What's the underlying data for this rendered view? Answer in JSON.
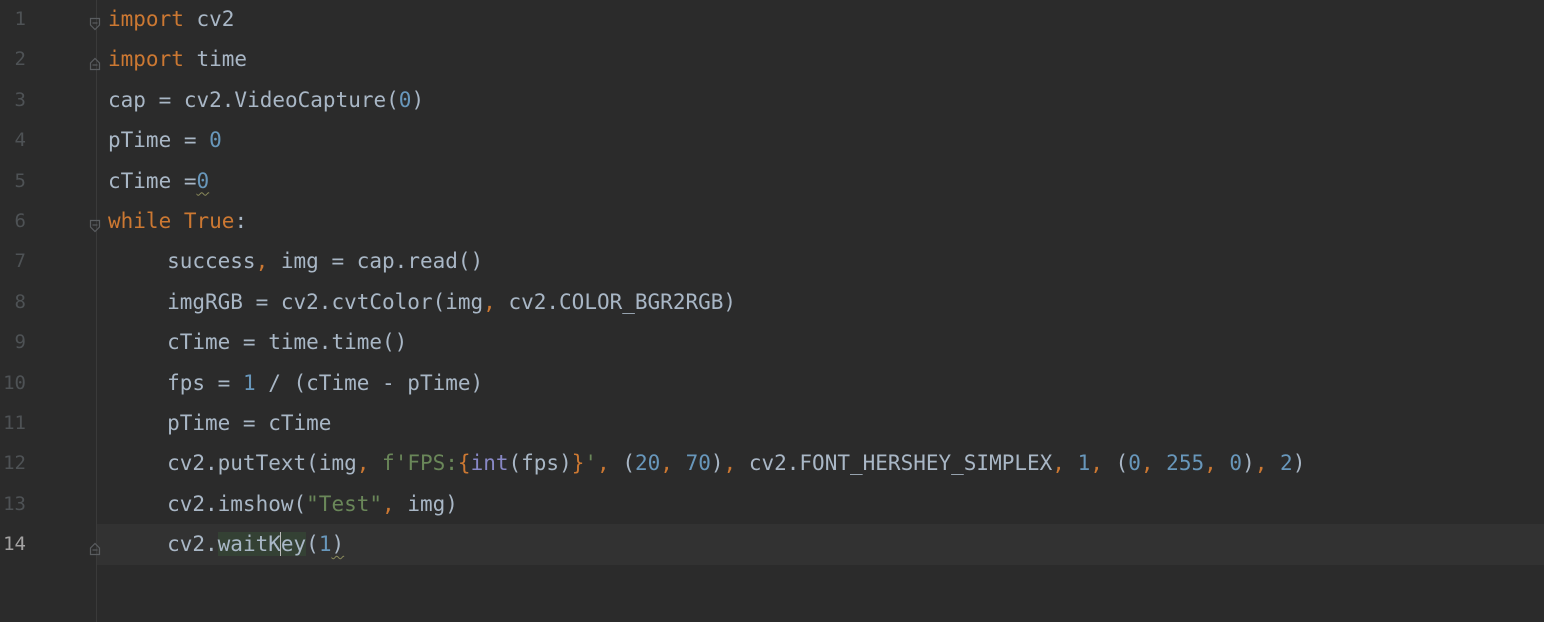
{
  "editor": {
    "current_line": 14,
    "caret": {
      "line": 14,
      "column": 14
    },
    "colors": {
      "background": "#2b2b2b",
      "current_line_background": "#323232",
      "keyword": "#cc7832",
      "number": "#6897bb",
      "string": "#6a8759",
      "builtin": "#8888c6",
      "default_text": "#a9b7c6",
      "line_number": "#4e5255",
      "current_line_number": "#a4a3a3"
    },
    "fold_markers": [
      {
        "line": 1,
        "icon": "fold-start-icon"
      },
      {
        "line": 2,
        "icon": "fold-end-icon"
      },
      {
        "line": 6,
        "icon": "fold-start-icon"
      },
      {
        "line": 14,
        "icon": "fold-end-icon"
      }
    ],
    "lines": [
      {
        "number": "1",
        "indent": 0,
        "tokens": [
          {
            "t": "import",
            "k": "kw"
          },
          {
            "t": " cv2",
            "k": "plain"
          }
        ]
      },
      {
        "number": "2",
        "indent": 0,
        "tokens": [
          {
            "t": "import",
            "k": "kw"
          },
          {
            "t": " time",
            "k": "plain"
          }
        ]
      },
      {
        "number": "3",
        "indent": 0,
        "tokens": [
          {
            "t": "cap = cv2.VideoCapture(",
            "k": "plain"
          },
          {
            "t": "0",
            "k": "num"
          },
          {
            "t": ")",
            "k": "plain"
          }
        ]
      },
      {
        "number": "4",
        "indent": 0,
        "tokens": [
          {
            "t": "pTime = ",
            "k": "plain"
          },
          {
            "t": "0",
            "k": "num"
          }
        ]
      },
      {
        "number": "5",
        "indent": 0,
        "tokens": [
          {
            "t": "cTime =",
            "k": "plain"
          },
          {
            "t": "0",
            "k": "num",
            "warn": true
          }
        ]
      },
      {
        "number": "6",
        "indent": 0,
        "tokens": [
          {
            "t": "while",
            "k": "kw"
          },
          {
            "t": " ",
            "k": "plain"
          },
          {
            "t": "True",
            "k": "kw"
          },
          {
            "t": ":",
            "k": "plain"
          }
        ]
      },
      {
        "number": "7",
        "indent": 4,
        "tokens": [
          {
            "t": "success",
            "k": "plain"
          },
          {
            "t": ",",
            "k": "punct"
          },
          {
            "t": " img = cap.read()",
            "k": "plain"
          }
        ]
      },
      {
        "number": "8",
        "indent": 4,
        "tokens": [
          {
            "t": "imgRGB = cv2.cvtColor(img",
            "k": "plain"
          },
          {
            "t": ",",
            "k": "punct"
          },
          {
            "t": " cv2.COLOR_BGR2RGB)",
            "k": "plain"
          }
        ]
      },
      {
        "number": "9",
        "indent": 4,
        "tokens": [
          {
            "t": "cTime = time.time()",
            "k": "plain"
          }
        ]
      },
      {
        "number": "10",
        "indent": 4,
        "tokens": [
          {
            "t": "fps = ",
            "k": "plain"
          },
          {
            "t": "1",
            "k": "num"
          },
          {
            "t": " / (cTime - pTime)",
            "k": "plain"
          }
        ]
      },
      {
        "number": "11",
        "indent": 4,
        "tokens": [
          {
            "t": "pTime = cTime",
            "k": "plain"
          }
        ]
      },
      {
        "number": "12",
        "indent": 4,
        "tokens": [
          {
            "t": "cv2.putText(img",
            "k": "plain"
          },
          {
            "t": ",",
            "k": "punct"
          },
          {
            "t": " ",
            "k": "plain"
          },
          {
            "t": "f'FPS:",
            "k": "str"
          },
          {
            "t": "{",
            "k": "fbrace"
          },
          {
            "t": "int",
            "k": "builtin"
          },
          {
            "t": "(fps)",
            "k": "plain"
          },
          {
            "t": "}",
            "k": "fbrace"
          },
          {
            "t": "'",
            "k": "str"
          },
          {
            "t": ",",
            "k": "punct"
          },
          {
            "t": " (",
            "k": "plain"
          },
          {
            "t": "20",
            "k": "num"
          },
          {
            "t": ",",
            "k": "punct"
          },
          {
            "t": " ",
            "k": "plain"
          },
          {
            "t": "70",
            "k": "num"
          },
          {
            "t": ")",
            "k": "plain"
          },
          {
            "t": ",",
            "k": "punct"
          },
          {
            "t": " cv2.FONT_HERSHEY_SIMPLEX",
            "k": "plain"
          },
          {
            "t": ",",
            "k": "punct"
          },
          {
            "t": " ",
            "k": "plain"
          },
          {
            "t": "1",
            "k": "num"
          },
          {
            "t": ",",
            "k": "punct"
          },
          {
            "t": " (",
            "k": "plain"
          },
          {
            "t": "0",
            "k": "num"
          },
          {
            "t": ",",
            "k": "punct"
          },
          {
            "t": " ",
            "k": "plain"
          },
          {
            "t": "255",
            "k": "num"
          },
          {
            "t": ",",
            "k": "punct"
          },
          {
            "t": " ",
            "k": "plain"
          },
          {
            "t": "0",
            "k": "num"
          },
          {
            "t": ")",
            "k": "plain"
          },
          {
            "t": ",",
            "k": "punct"
          },
          {
            "t": " ",
            "k": "plain"
          },
          {
            "t": "2",
            "k": "num"
          },
          {
            "t": ")",
            "k": "plain"
          }
        ]
      },
      {
        "number": "13",
        "indent": 4,
        "tokens": [
          {
            "t": "cv2.imshow(",
            "k": "plain"
          },
          {
            "t": "\"Test\"",
            "k": "str"
          },
          {
            "t": ",",
            "k": "punct"
          },
          {
            "t": " img)",
            "k": "plain"
          }
        ]
      },
      {
        "number": "14",
        "indent": 4,
        "tokens": [
          {
            "t": "cv2.",
            "k": "plain"
          },
          {
            "t": "waitK",
            "k": "plain",
            "hl": true
          },
          {
            "t": "",
            "k": "caret"
          },
          {
            "t": "ey",
            "k": "plain",
            "hl": true
          },
          {
            "t": "(",
            "k": "plain"
          },
          {
            "t": "1",
            "k": "num"
          },
          {
            "t": ")",
            "k": "plain",
            "warn": true
          }
        ]
      }
    ]
  }
}
